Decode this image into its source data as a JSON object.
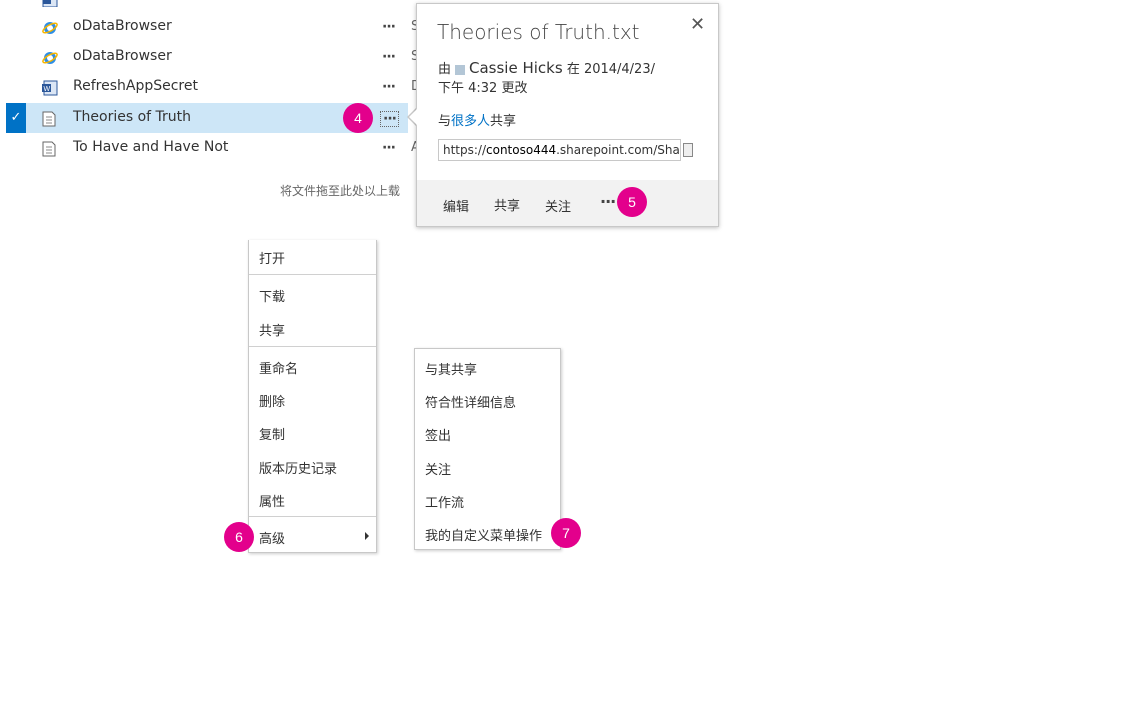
{
  "file_list": {
    "rows": [
      {
        "name": "oDataBrowser",
        "icon": "ie-icon",
        "trail": "S"
      },
      {
        "name": "oDataBrowser",
        "icon": "ie-icon",
        "trail": "S"
      },
      {
        "name": "RefreshAppSecret",
        "icon": "word-doc-icon",
        "trail": "D"
      },
      {
        "name": "Theories of Truth",
        "icon": "text-file-icon",
        "trail": ""
      },
      {
        "name": "To Have and Have Not",
        "icon": "text-file-icon",
        "trail": "A"
      }
    ],
    "ellipsis": "···",
    "checkmark": "✓",
    "drop_hint": "将文件拖至此处以上载"
  },
  "callout": {
    "title": "Theories of Truth.txt",
    "close_glyph": "✕",
    "meta_prefix": "由",
    "author": "Cassie Hicks",
    "meta_at": "在 2014/4/23/",
    "meta_time": "下午 4:32 更改",
    "shared_prefix": "与",
    "shared_link": "很多人",
    "shared_suffix": "共享",
    "url_prefix": "https://",
    "url_host": "contoso444",
    "url_rest": ".sharepoint.com/Sha",
    "actions": {
      "edit": "编辑",
      "share": "共享",
      "follow": "关注",
      "more": "···"
    }
  },
  "context_menu": {
    "open": "打开",
    "download": "下载",
    "share": "共享",
    "rename": "重命名",
    "delete": "删除",
    "copy": "复制",
    "version_history": "版本历史记录",
    "properties": "属性",
    "advanced": "高级"
  },
  "advanced_menu": {
    "share_with": "与其共享",
    "compliance_details": "符合性详细信息",
    "check_out": "签出",
    "follow": "关注",
    "workflow": "工作流",
    "custom_action": "我的自定义菜单操作"
  },
  "badges": [
    "4",
    "5",
    "6",
    "7"
  ],
  "colors": {
    "accent": "#0072c6",
    "badge": "#e3008c",
    "selected_row": "#cde6f7"
  }
}
